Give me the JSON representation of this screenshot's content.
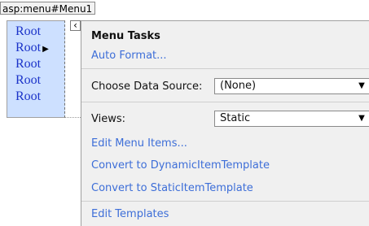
{
  "control_tag": "asp:menu#Menu1",
  "menu": {
    "items": [
      "Root",
      "Root",
      "Root",
      "Root",
      "Root"
    ],
    "submenu_arrow": "▶"
  },
  "tasks_panel": {
    "title": "Menu Tasks",
    "auto_format": "Auto Format...",
    "data_source": {
      "label": "Choose Data Source:",
      "value": "(None)"
    },
    "views": {
      "label": "Views:",
      "value": "Static"
    },
    "links": [
      "Edit Menu Items...",
      "Convert to DynamicItemTemplate",
      "Convert to StaticItemTemplate",
      "Edit Templates"
    ],
    "collapse_glyph": "‹"
  },
  "colors": {
    "menu_bg": "#cde0ff",
    "menu_text": "#1b33c9",
    "panel_bg": "#f0f0f0",
    "link": "#3d6ed8"
  }
}
